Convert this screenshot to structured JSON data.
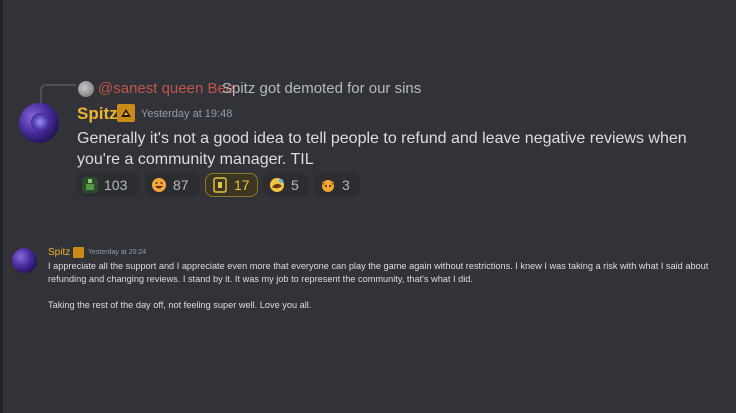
{
  "reply": {
    "username": "@sanest queen Bee",
    "text": "Spitz got demoted for our sins"
  },
  "message1": {
    "author": "Spitz",
    "timestamp": "Yesterday at 19:48",
    "text": "Generally it's not a good idea to tell people to refund and leave negative reviews when you're a community manager. TIL",
    "reactions": [
      {
        "icon": "green-figure-emoji",
        "count": "103"
      },
      {
        "icon": "laughing-face-emoji",
        "count": "87"
      },
      {
        "icon": "yellow-frame-emoji",
        "count": "17",
        "active": true
      },
      {
        "icon": "rolling-laugh-emoji",
        "count": "5"
      },
      {
        "icon": "dog-emoji",
        "count": "3"
      }
    ]
  },
  "message2": {
    "author": "Spitz",
    "timestamp": "Yesterday at 20:24",
    "paragraphs": [
      "I appreciate all the support and I appreciate even more that everyone can play the game again without restrictions. I knew I was taking a risk with what I said about refunding and changing reviews. I stand by it. It was my job to represent the community, that's what I did.",
      "Taking the rest of the day off, not feeling super well. Love you all."
    ]
  },
  "colors": {
    "background": "#313338",
    "username": "#f0b232",
    "reply_mention": "#c0564d",
    "timestamp": "#949ba4"
  }
}
